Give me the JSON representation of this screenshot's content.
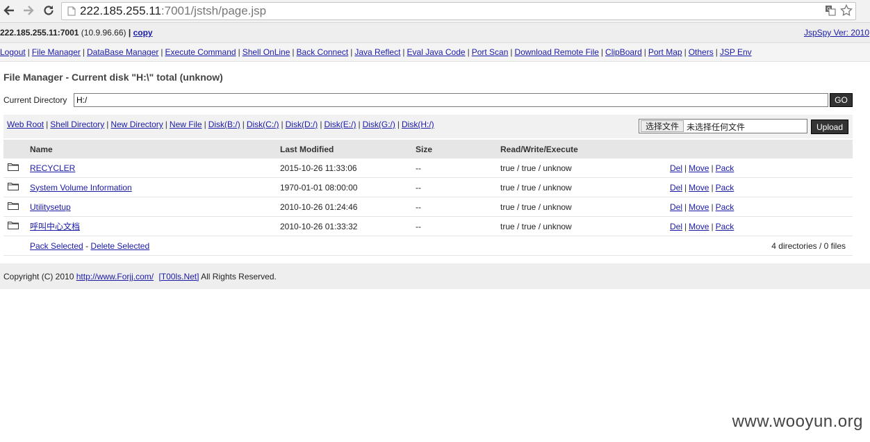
{
  "browser": {
    "url_host": "222.185.255.11",
    "url_rest": ":7001/jstsh/page.jsp"
  },
  "infobar": {
    "host": "222.185.255.11:7001",
    "ip": "(10.9.96.66)",
    "separator": "|",
    "copy_label": "copy",
    "version_label": "JspSpy Ver: 2010"
  },
  "menu": {
    "items": [
      "Logout",
      "File Manager",
      "DataBase Manager",
      "Execute Command",
      "Shell OnLine",
      "Back Connect",
      "Java Reflect",
      "Eval Java Code",
      "Port Scan",
      "Download Remote File",
      "ClipBoard",
      "Port Map",
      "Others",
      "JSP Env"
    ]
  },
  "page": {
    "title": "File Manager - Current disk \"H:\\\" total (unknow)",
    "curdir_label": "Current Directory",
    "curdir_value": "H:/",
    "go_label": "GO"
  },
  "disks": {
    "links": [
      "Web Root",
      "Shell Directory",
      "New Directory",
      "New File",
      "Disk(B:/)",
      "Disk(C:/)",
      "Disk(D:/)",
      "Disk(E:/)",
      "Disk(G:/)",
      "Disk(H:/)"
    ]
  },
  "upload": {
    "choose_label": "选择文件",
    "no_file_label": "未选择任何文件",
    "upload_label": "Upload"
  },
  "table": {
    "headers": [
      "Name",
      "Last Modified",
      "Size",
      "Read/Write/Execute"
    ],
    "rows": [
      {
        "name": "RECYCLER",
        "modified": "2015-10-26 11:33:06",
        "size": "--",
        "rwx": "true / true / unknow"
      },
      {
        "name": "System Volume Information",
        "modified": "1970-01-01 08:00:00",
        "size": "--",
        "rwx": "true / true / unknow"
      },
      {
        "name": "Utilitysetup",
        "modified": "2010-10-26 01:24:46",
        "size": "--",
        "rwx": "true / true / unknow"
      },
      {
        "name": "呼叫中心文档",
        "modified": "2010-10-26 01:33:32",
        "size": "--",
        "rwx": "true / true / unknow"
      }
    ],
    "actions": [
      "Del",
      "Move",
      "Pack"
    ],
    "pack_selected": "Pack Selected",
    "dash": "-",
    "delete_selected": "Delete Selected",
    "summary": "4 directories / 0 files"
  },
  "footer": {
    "prefix": "Copyright (C) 2010",
    "site_link": "http://www.Forjj.com/",
    "team_link": "[T00ls.Net]",
    "suffix": "All Rights Reserved."
  },
  "watermark": "www.wooyun.org",
  "icons": {
    "back": "back-arrow-icon",
    "forward": "forward-arrow-icon",
    "reload": "reload-icon",
    "page": "page-icon",
    "translate": "translate-icon",
    "star": "star-icon",
    "folder": "folder-icon"
  }
}
